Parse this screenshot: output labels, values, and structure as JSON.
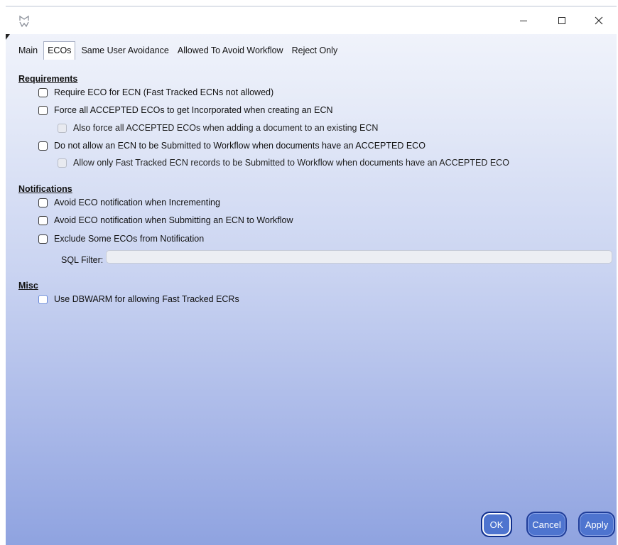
{
  "window": {
    "icon": "app-logo-icon",
    "controls": {
      "minimize": "—",
      "maximize": "☐",
      "close": "✕"
    }
  },
  "tabs": [
    {
      "label": "Main",
      "active": false
    },
    {
      "label": "ECOs",
      "active": true
    },
    {
      "label": "Same User Avoidance",
      "active": false
    },
    {
      "label": "Allowed To Avoid Workflow",
      "active": false
    },
    {
      "label": "Reject Only",
      "active": false
    }
  ],
  "sections": {
    "requirements": {
      "title": "Requirements",
      "options": [
        {
          "label": "Require ECO for ECN (Fast Tracked ECNs not allowed)",
          "checked": false,
          "enabled": true
        },
        {
          "label": "Force all ACCEPTED ECOs to get Incorporated when creating an ECN",
          "checked": false,
          "enabled": true
        },
        {
          "label": "Also force all ACCEPTED ECOs when adding a document to an existing ECN",
          "checked": false,
          "enabled": false
        },
        {
          "label": "Do not allow an ECN to be Submitted to Workflow when documents have an ACCEPTED ECO",
          "checked": false,
          "enabled": true
        },
        {
          "label": "Allow only Fast Tracked ECN records to be Submitted to Workflow when documents have an ACCEPTED ECO",
          "checked": false,
          "enabled": false
        }
      ]
    },
    "notifications": {
      "title": "Notifications",
      "options": [
        {
          "label": "Avoid ECO notification when Incrementing",
          "checked": false,
          "enabled": true
        },
        {
          "label": "Avoid ECO notification when Submitting an ECN to Workflow",
          "checked": false,
          "enabled": true
        },
        {
          "label": "Exclude Some ECOs from Notification",
          "checked": false,
          "enabled": true
        }
      ],
      "sql_filter": {
        "label": "SQL Filter:",
        "value": ""
      }
    },
    "misc": {
      "title": "Misc",
      "options": [
        {
          "label": "Use DBWARM for allowing Fast Tracked ECRs",
          "checked": false,
          "enabled": true
        }
      ]
    }
  },
  "buttons": {
    "ok": "OK",
    "cancel": "Cancel",
    "apply": "Apply"
  },
  "colors": {
    "button_fill": "#4e74cf",
    "button_border": "#1f3d99",
    "background_bottom": "#8fa3e0"
  }
}
